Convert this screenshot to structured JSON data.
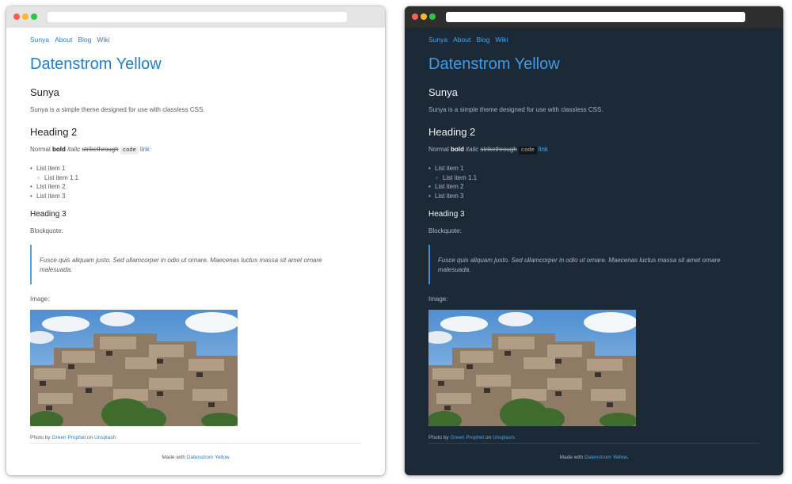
{
  "windows": {
    "light": {
      "nav": [
        "Sunya",
        "About",
        "Blog",
        "Wiki"
      ],
      "site_title": "Datenstrom Yellow",
      "section_heading": "Sunya",
      "intro": "Sunya is a simple theme designed for use with classless CSS.",
      "heading2": "Heading 2",
      "formatting": {
        "normal": "Normal",
        "bold": "bold",
        "italic": "italic",
        "strike": "strikethrough",
        "code": "code",
        "link": "link"
      },
      "list": {
        "item1": "List item 1",
        "item1_1": "List item 1.1",
        "item2": "List item 2",
        "item3": "List item 3"
      },
      "heading3": "Heading 3",
      "blockquote_label": "Blockquote:",
      "blockquote": "Fusce quis aliquam justo. Sed ullamcorper in odio ut ornare. Maecenas luctus massa sit amet ornare malesuada.",
      "image_label": "Image:",
      "caption": {
        "prefix": "Photo by",
        "author": "Green Prophet",
        "mid": "on",
        "site": "Unsplash",
        "end": ""
      },
      "footer": {
        "prefix": "Made with",
        "link": "Datenstrom Yellow",
        "end": ""
      }
    },
    "dark": {
      "nav": [
        "Sunya",
        "About",
        "Blog",
        "Wiki"
      ],
      "site_title": "Datenstrom Yellow",
      "section_heading": "Sunya",
      "intro": "Sunya is a simple theme designed for use with classless CSS.",
      "heading2": "Heading 2",
      "formatting": {
        "normal": "Normal",
        "bold": "bold",
        "italic": "italic",
        "strike": "strikethrough",
        "code": "code",
        "link": "link"
      },
      "list": {
        "item1": "List item 1",
        "item1_1": "List item 1.1",
        "item2": "List item 2",
        "item3": "List item 3"
      },
      "heading3": "Heading 3",
      "blockquote_label": "Blockquote:",
      "blockquote": "Fusce quis aliquam justo. Sed ullamcorper in odio ut ornare. Maecenas luctus massa sit amet ornare malesuada.",
      "image_label": "Image:",
      "caption": {
        "prefix": "Photo by",
        "author": "Green Prophet",
        "mid": "on",
        "site": "Unsplash",
        "end": "."
      },
      "footer": {
        "prefix": "Made with",
        "link": "Datenstrom Yellow",
        "end": "."
      }
    }
  },
  "colors": {
    "light_background": "#ffffff",
    "dark_background": "#1c2a38",
    "link_light": "#2a7ec9",
    "link_dark": "#4aa3e8"
  }
}
